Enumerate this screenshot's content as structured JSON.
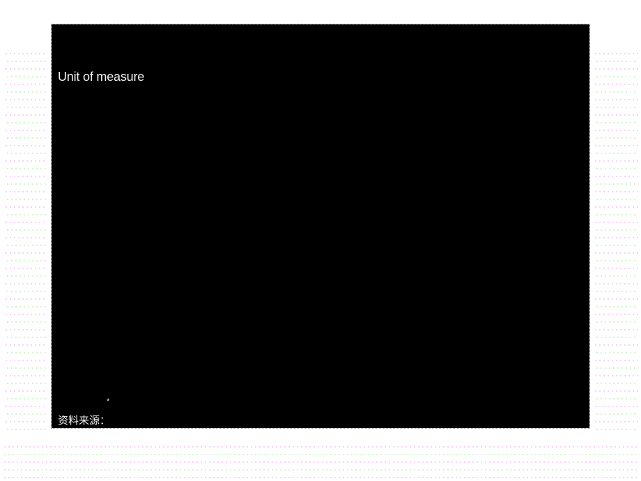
{
  "slide": {
    "unit_label": "Unit of measure",
    "footnote_marker": "*",
    "source_label": "资料来源："
  },
  "colors": {
    "slide_background": "#000000",
    "page_background": "#ffffff",
    "text": "#f2f2f2",
    "margin_dot_pink": "#f3c6f0",
    "margin_dot_green": "#c8f0c0"
  }
}
